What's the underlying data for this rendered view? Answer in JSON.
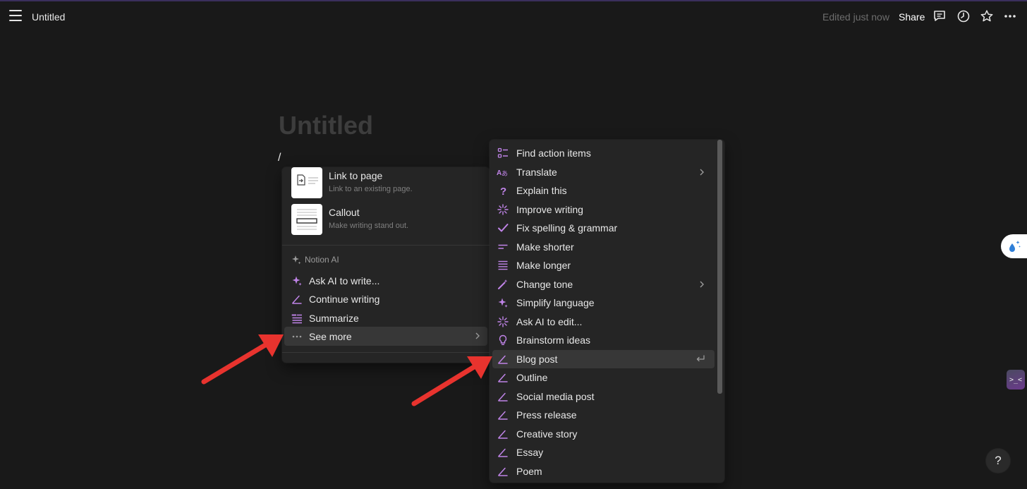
{
  "topbar": {
    "title": "Untitled",
    "edited": "Edited just now",
    "share": "Share",
    "icons": [
      "menu-icon",
      "comment-icon",
      "clock-icon",
      "star-icon",
      "more-icon"
    ]
  },
  "page": {
    "title": "Untitled",
    "typed_text": "/"
  },
  "block_menu": {
    "items": [
      {
        "name": "Link to page",
        "description": "Link to an existing page."
      },
      {
        "name": "Callout",
        "description": "Make writing stand out."
      }
    ],
    "section_title": "Notion AI",
    "ai_items": [
      {
        "label": "Ask AI to write...",
        "icon": "sparkle-icon"
      },
      {
        "label": "Continue writing",
        "icon": "pen-icon"
      },
      {
        "label": "Summarize",
        "icon": "summarize-icon"
      },
      {
        "label": "See more",
        "icon": "dots-icon"
      }
    ]
  },
  "ai_menu": {
    "items": [
      {
        "label": "Find action items",
        "icon": "checklist-icon"
      },
      {
        "label": "Translate",
        "icon": "translate-icon"
      },
      {
        "label": "Explain this",
        "icon": "question-icon"
      },
      {
        "label": "Improve writing",
        "icon": "burst-icon"
      },
      {
        "label": "Fix spelling & grammar",
        "icon": "check-icon"
      },
      {
        "label": "Make shorter",
        "icon": "short-lines-icon"
      },
      {
        "label": "Make longer",
        "icon": "long-lines-icon"
      },
      {
        "label": "Change tone",
        "icon": "wand-icon"
      },
      {
        "label": "Simplify language",
        "icon": "sparkle-icon"
      },
      {
        "label": "Ask AI to edit...",
        "icon": "burst-icon"
      },
      {
        "label": "Brainstorm ideas",
        "icon": "bulb-icon"
      },
      {
        "label": "Blog post",
        "icon": "pen-icon"
      },
      {
        "label": "Outline",
        "icon": "pen-icon"
      },
      {
        "label": "Social media post",
        "icon": "pen-icon"
      },
      {
        "label": "Press release",
        "icon": "pen-icon"
      },
      {
        "label": "Creative story",
        "icon": "pen-icon"
      },
      {
        "label": "Essay",
        "icon": "pen-icon"
      },
      {
        "label": "Poem",
        "icon": "pen-icon"
      }
    ],
    "highlighted": "Blog post"
  },
  "floating": {
    "help_label": "?",
    "face_label": ">_<"
  },
  "colors": {
    "background": "#191919",
    "menu": "#252525",
    "accent_ai": "#c084e8",
    "annotation_arrow": "#e8332e"
  }
}
